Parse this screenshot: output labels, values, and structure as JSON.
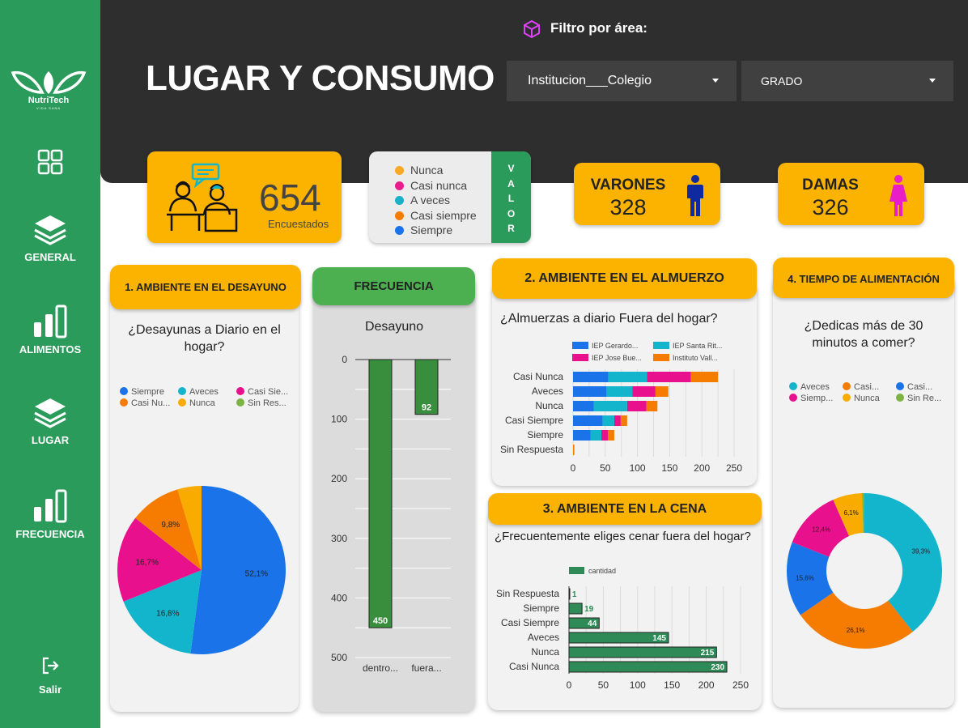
{
  "sidebar": {
    "logo_text": "NutriTech",
    "logo_sub": "VIDA SANA",
    "items": [
      {
        "label": "",
        "icon": "dashboard-grid-icon"
      },
      {
        "label": "GENERAL",
        "icon": "layers-icon"
      },
      {
        "label": "ALIMENTOS",
        "icon": "bar-chart-icon"
      },
      {
        "label": "LUGAR",
        "icon": "layers-icon"
      },
      {
        "label": "FRECUENCIA",
        "icon": "bar-chart-icon"
      },
      {
        "label": "Salir",
        "icon": "logout-icon"
      }
    ]
  },
  "header": {
    "title": "LUGAR Y CONSUMO",
    "filter_label": "Filtro por área:",
    "select_institution": "Institucion___Colegio",
    "select_grade": "GRADO"
  },
  "kpi": {
    "respondents_value": "654",
    "respondents_label": "Encuestados",
    "men_label": "VARONES",
    "men_value": "328",
    "women_label": "DAMAS",
    "women_value": "326"
  },
  "value_legend": {
    "title_letters": [
      "V",
      "A",
      "L",
      "O",
      "R"
    ],
    "items": [
      {
        "label": "Nunca",
        "color": "#f9a825"
      },
      {
        "label": "Casi nunca",
        "color": "#e91e8c"
      },
      {
        "label": "A veces",
        "color": "#1ab0c8"
      },
      {
        "label": "Casi siempre",
        "color": "#f57c00"
      },
      {
        "label": "Siempre",
        "color": "#1a73e8"
      }
    ]
  },
  "panels": {
    "breakfast": {
      "header": "1. AMBIENTE EN EL DESAYUNO",
      "question": "¿Desayunas a Diario en el hogar?",
      "legend": [
        {
          "label": "Siempre",
          "color": "#1a73e8"
        },
        {
          "label": "Aveces",
          "color": "#12b5cb"
        },
        {
          "label": "Casi Sie...",
          "color": "#e8108c"
        },
        {
          "label": "Casi Nu...",
          "color": "#f57c00"
        },
        {
          "label": "Nunca",
          "color": "#f9ab00"
        },
        {
          "label": "Sin Res...",
          "color": "#7cb342"
        }
      ]
    },
    "frequency": {
      "header": "FRECUENCIA",
      "chart_title": "Desayuno"
    },
    "lunch": {
      "header": "2. AMBIENTE EN EL ALMUERZO",
      "question": "¿Almuerzas a diario Fuera del hogar?"
    },
    "dinner": {
      "header": "3. AMBIENTE EN LA CENA",
      "question": "¿Frecuentemente eliges cenar fuera del hogar?"
    },
    "time": {
      "header": "4. TIEMPO DE ALIMENTACIÓN",
      "question": "¿Dedicas más de 30 minutos a comer?",
      "legend": [
        {
          "label": "Aveces",
          "color": "#12b5cb"
        },
        {
          "label": "Casi...",
          "color": "#f57c00"
        },
        {
          "label": "Casi...",
          "color": "#1a73e8"
        },
        {
          "label": "Siemp...",
          "color": "#e8108c"
        },
        {
          "label": "Nunca",
          "color": "#f9ab00"
        },
        {
          "label": "Sin Re...",
          "color": "#7cb342"
        }
      ]
    }
  },
  "chart_data": [
    {
      "id": "breakfast_pie",
      "type": "pie",
      "title": "¿Desayunas a Diario en el hogar?",
      "slices": [
        {
          "label": "Siempre",
          "value": 52.1,
          "display": "52,1%",
          "color": "#1a73e8"
        },
        {
          "label": "Aveces",
          "value": 16.8,
          "display": "16,8%",
          "color": "#12b5cb"
        },
        {
          "label": "Casi Siempre",
          "value": 16.7,
          "display": "16,7%",
          "color": "#e8108c"
        },
        {
          "label": "Casi Nunca",
          "value": 9.8,
          "display": "9,8%",
          "color": "#f57c00"
        },
        {
          "label": "Nunca",
          "value": 4.6,
          "display": "",
          "color": "#f9ab00"
        }
      ]
    },
    {
      "id": "frequency_bar",
      "type": "bar",
      "title": "Desayuno",
      "categories": [
        "dentro...",
        "fuera..."
      ],
      "values": [
        450,
        92
      ],
      "ylim": [
        0,
        500
      ],
      "yticks": [
        0,
        100,
        200,
        300,
        400,
        500
      ],
      "color": "#388e3c"
    },
    {
      "id": "lunch_stacked",
      "type": "bar",
      "title": "¿Almuerzas a diario Fuera del hogar?",
      "categories": [
        "Casi Nunca",
        "Aveces",
        "Nunca",
        "Casi Siempre",
        "Siempre",
        "Sin Respuesta"
      ],
      "series": [
        {
          "name": "IEP Gerardo...",
          "color": "#1a73e8",
          "values": [
            55,
            52,
            32,
            46,
            27,
            0
          ]
        },
        {
          "name": "IEP Santa Rit...",
          "color": "#12b5cb",
          "values": [
            60,
            40,
            52,
            18,
            17,
            0
          ]
        },
        {
          "name": "IEP Jose Bue...",
          "color": "#e8108c",
          "values": [
            68,
            36,
            30,
            10,
            10,
            0
          ]
        },
        {
          "name": "Instituto Vall...",
          "color": "#f57c00",
          "values": [
            42,
            20,
            17,
            10,
            10,
            2
          ]
        }
      ],
      "xlim": [
        0,
        250
      ],
      "xticks": [
        0,
        50,
        100,
        150,
        200,
        250
      ]
    },
    {
      "id": "dinner_bar",
      "type": "bar",
      "title": "¿Frecuentemente eliges cenar fuera del hogar?",
      "legend": "cantidad",
      "categories": [
        "Sin Respuesta",
        "Siempre",
        "Casi Siempre",
        "Aveces",
        "Nunca",
        "Casi Nunca"
      ],
      "values": [
        1,
        19,
        44,
        145,
        215,
        230
      ],
      "xlim": [
        0,
        250
      ],
      "xticks": [
        0,
        50,
        100,
        150,
        200,
        250
      ],
      "color": "#2e8b57"
    },
    {
      "id": "time_donut",
      "type": "pie",
      "title": "¿Dedicas más de 30 minutos a comer?",
      "slices": [
        {
          "label": "Aveces",
          "value": 39.3,
          "display": "39,3%",
          "color": "#12b5cb"
        },
        {
          "label": "Casi...",
          "value": 26.1,
          "display": "26,1%",
          "color": "#f57c00"
        },
        {
          "label": "Casi...",
          "value": 15.6,
          "display": "15,6%",
          "color": "#1a73e8"
        },
        {
          "label": "Siemp...",
          "value": 12.4,
          "display": "12,4%",
          "color": "#e8108c"
        },
        {
          "label": "Nunca",
          "value": 6.1,
          "display": "6,1%",
          "color": "#f9ab00"
        },
        {
          "label": "Sin Re...",
          "value": 0.5,
          "display": "",
          "color": "#7cb342"
        }
      ]
    }
  ]
}
